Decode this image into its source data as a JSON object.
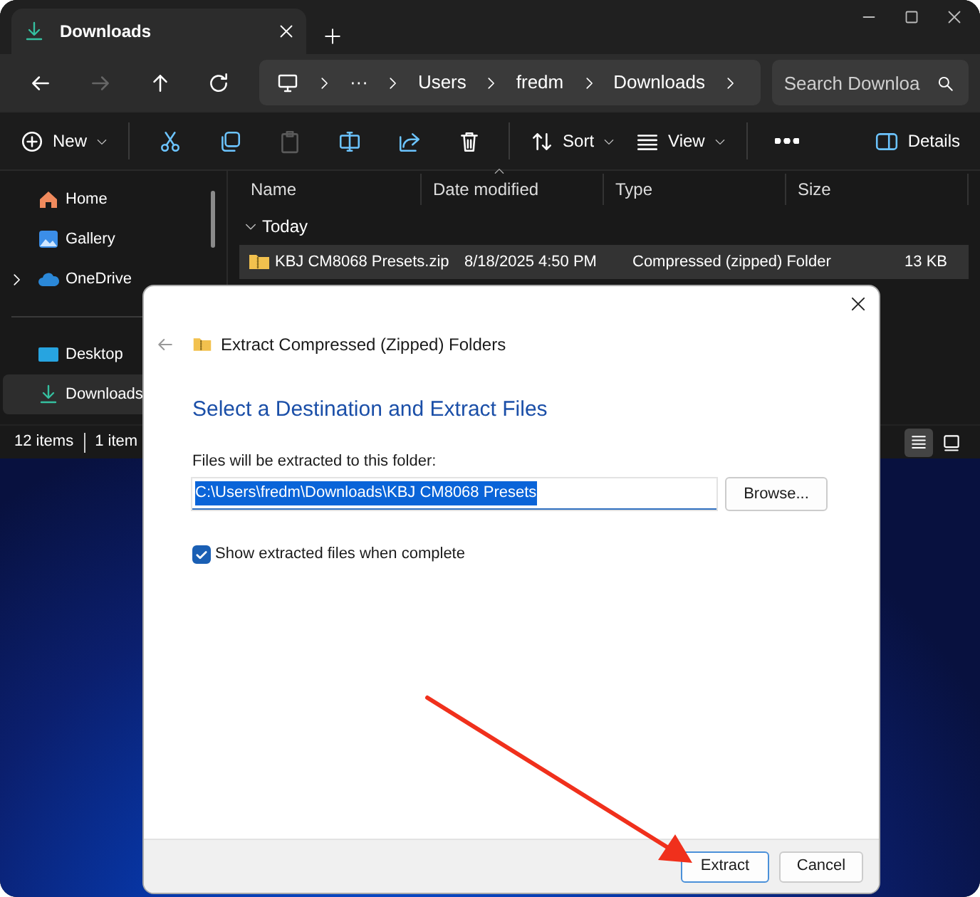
{
  "explorer": {
    "tab": {
      "title": "Downloads"
    },
    "nav_buttons": [
      {
        "kind": "back",
        "disabled": false
      },
      {
        "kind": "forward",
        "disabled": true
      },
      {
        "kind": "up",
        "disabled": false
      },
      {
        "kind": "refresh",
        "disabled": false
      }
    ],
    "breadcrumb": [
      "···",
      "Users",
      "fredm",
      "Downloads"
    ],
    "search": {
      "placeholder": "Search Downloa"
    },
    "toolbar": [
      {
        "kind": "new",
        "label": "New",
        "dropdown": true,
        "disabled": false
      },
      {
        "kind": "cut",
        "disabled": false
      },
      {
        "kind": "copy",
        "disabled": false
      },
      {
        "kind": "paste",
        "disabled": true
      },
      {
        "kind": "rename",
        "disabled": false
      },
      {
        "kind": "share",
        "disabled": false
      },
      {
        "kind": "delete",
        "disabled": false
      },
      {
        "kind": "sort",
        "label": "Sort",
        "dropdown": true,
        "disabled": false
      },
      {
        "kind": "view",
        "label": "View",
        "dropdown": true,
        "disabled": false
      },
      {
        "kind": "more",
        "disabled": false
      },
      {
        "kind": "details",
        "label": "Details",
        "disabled": false
      }
    ],
    "sidebar": {
      "items": [
        {
          "kind": "home",
          "label": "Home",
          "expandable": false,
          "selected": false
        },
        {
          "kind": "gallery",
          "label": "Gallery",
          "expandable": false,
          "selected": false
        },
        {
          "kind": "onedrive",
          "label": "OneDrive",
          "expandable": true,
          "selected": false
        },
        {
          "kind": "desktop",
          "label": "Desktop",
          "expandable": false,
          "selected": false
        },
        {
          "kind": "downloads",
          "label": "Downloads",
          "expandable": false,
          "selected": true
        }
      ]
    },
    "columns": [
      {
        "label": "Name",
        "sorted": false
      },
      {
        "label": "Date modified",
        "sorted": true
      },
      {
        "label": "Type",
        "sorted": false
      },
      {
        "label": "Size",
        "sorted": false
      }
    ],
    "groups": [
      {
        "label": "Today",
        "expanded": true,
        "rows": [
          {
            "name": "KBJ CM8068 Presets.zip",
            "date": "8/18/2025 4:50 PM",
            "type": "Compressed (zipped) Folder",
            "size": "13 KB",
            "selected": true
          }
        ]
      }
    ],
    "status_bar": {
      "count": "12 items",
      "selection": "1 item"
    },
    "view_buttons": [
      {
        "kind": "details",
        "selected": true
      },
      {
        "kind": "tiles",
        "selected": false
      }
    ]
  },
  "dialog": {
    "title": "Extract Compressed (Zipped) Folders",
    "heading": "Select a Destination and Extract Files",
    "field_label": "Files will be extracted to this folder:",
    "path": "C:\\Users\\fredm\\Downloads\\KBJ CM8068 Presets",
    "path_selected": true,
    "browse": "Browse...",
    "checkbox": {
      "label": "Show extracted files when complete",
      "checked": true
    },
    "buttons": [
      {
        "label": "Extract",
        "default": true
      },
      {
        "label": "Cancel",
        "default": false
      }
    ]
  }
}
